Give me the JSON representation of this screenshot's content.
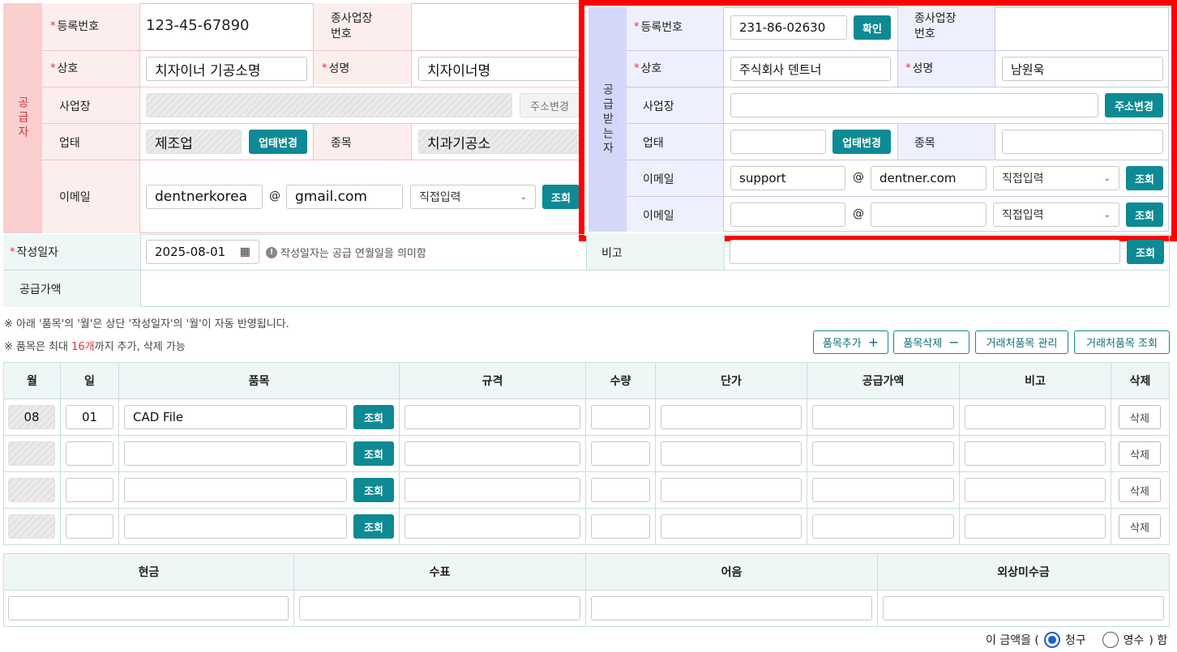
{
  "supplier": {
    "section_label": "공급자",
    "reg_no_label": "등록번호",
    "reg_no_value": "123-45-67890",
    "sub_biz_label": "종사업장\n번호",
    "company_label": "상호",
    "company_value": "치자이너 기공소명",
    "name_label": "성명",
    "name_value": "치자이너명",
    "address_label": "사업장",
    "address_button": "주소변경",
    "biz_type_label": "업태",
    "biz_type_value": "제조업",
    "biz_type_button": "업태변경",
    "item_label": "종목",
    "item_value": "치과기공소",
    "email_label": "이메일",
    "email_user": "dentnerkorea",
    "email_domain": "gmail.com",
    "email_select": "직접입력",
    "lookup_button": "조회"
  },
  "receiver": {
    "section_label": "공급받는자",
    "reg_no_label": "등록번호",
    "reg_no_value": "231-86-02630",
    "confirm_button": "확인",
    "sub_biz_label": "종사업장\n번호",
    "company_label": "상호",
    "company_value": "주식회사 덴트너",
    "name_label": "성명",
    "name_value": "남원욱",
    "address_label": "사업장",
    "address_button": "주소변경",
    "biz_type_label": "업태",
    "biz_type_button": "업태변경",
    "item_label": "종목",
    "email_label": "이메일",
    "email1_user": "support",
    "email1_domain": "dentner.com",
    "email1_select": "직접입력",
    "email2_label": "이메일",
    "email2_select": "직접입력",
    "lookup_button": "조회"
  },
  "date_row": {
    "date_label": "작성일자",
    "date_value": "2025-08-01",
    "date_hint": "작성일자는 공급 연월일을 의미함",
    "note_label": "비고",
    "lookup_button": "조회",
    "supply_amount_label": "공급가액"
  },
  "notes": {
    "note1": "※ 아래 '품목'의 '월'은 상단 '작성일자'의 '월'이 자동 반영됩니다.",
    "note2_prefix": "※ 품목은 최대 ",
    "note2_highlight": "16개",
    "note2_suffix": "까지 추가, 삭제 가능"
  },
  "item_buttons": {
    "add": "품목추가",
    "remove": "품목삭제",
    "manage": "거래처품목 관리",
    "lookup": "거래처품목 조회"
  },
  "items_table": {
    "headers": [
      "월",
      "일",
      "품목",
      "규격",
      "수량",
      "단가",
      "공급가액",
      "비고",
      "삭제"
    ],
    "rows": [
      {
        "month": "08",
        "day": "01",
        "item": "CAD File"
      },
      {
        "month": "",
        "day": "",
        "item": ""
      },
      {
        "month": "",
        "day": "",
        "item": ""
      },
      {
        "month": "",
        "day": "",
        "item": ""
      }
    ],
    "lookup_button": "조회",
    "delete_button": "삭제"
  },
  "payment_table": {
    "headers": [
      "현금",
      "수표",
      "어음",
      "외상미수금"
    ]
  },
  "footer": {
    "prefix": "이 금액을 (",
    "option1": "청구",
    "option2": "영수",
    "suffix": ") 함",
    "selected": "청구"
  },
  "colors": {
    "supplier_bg": "#fdeeee",
    "supplier_header": "#f9c9c9",
    "receiver_bg": "#eef0fd",
    "receiver_header": "#d3d8fa",
    "teal": "#0d8a94",
    "highlight_border": "#ff0000"
  }
}
